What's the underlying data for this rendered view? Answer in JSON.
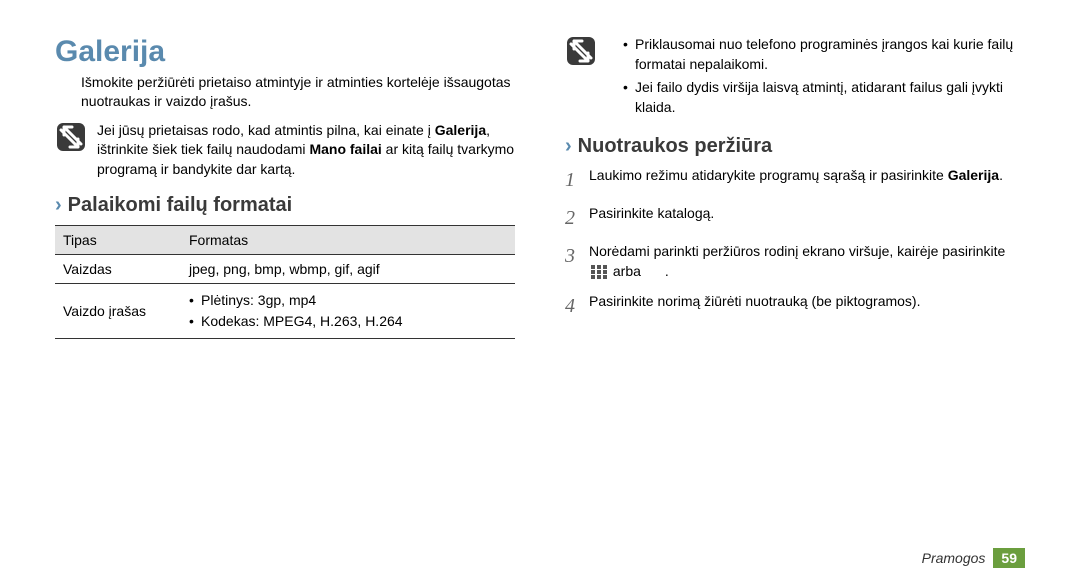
{
  "title": "Galerija",
  "intro": "Išmokite peržiūrėti prietaiso atmintyje ir atminties kortelėje išsaugotas nuotraukas ir vaizdo įrašus.",
  "note_left": {
    "pre": "Jei jūsų prietaisas rodo, kad atmintis pilna, kai einate į ",
    "bold1": "Galerija",
    "mid": ", ištrinkite šiek tiek failų naudodami ",
    "bold2": "Mano failai",
    "post": " ar kitą failų tvarkymo programą ir bandykite dar kartą."
  },
  "section1": "Palaikomi failų formatai",
  "table": {
    "head": {
      "c1": "Tipas",
      "c2": "Formatas"
    },
    "row1": {
      "c1": "Vaizdas",
      "c2": "jpeg, png, bmp, wbmp, gif, agif"
    },
    "row2": {
      "c1": "Vaizdo įrašas",
      "b1": "Plėtinys: 3gp, mp4",
      "b2": "Kodekas: MPEG4, H.263, H.264"
    }
  },
  "note_right": {
    "b1": "Priklausomai nuo telefono programinės įrangos kai kurie failų formatai nepalaikomi.",
    "b2": "Jei failo dydis viršija laisvą atmintį, atidarant failus gali įvykti klaida."
  },
  "section2": "Nuotraukos peržiūra",
  "steps": {
    "s1a": "Laukimo režimu atidarykite programų sąrašą ir pasirinkite ",
    "s1b": "Galerija",
    "s1c": ".",
    "s2": "Pasirinkite katalogą.",
    "s3a": "Norėdami parinkti peržiūros rodinį ekrano viršuje, kairėje pasirinkite ",
    "s3b": " arba ",
    "s3c": ".",
    "s4": "Pasirinkite norimą žiūrėti nuotrauką (be piktogramos)."
  },
  "footer": {
    "label": "Pramogos",
    "page": "59"
  }
}
